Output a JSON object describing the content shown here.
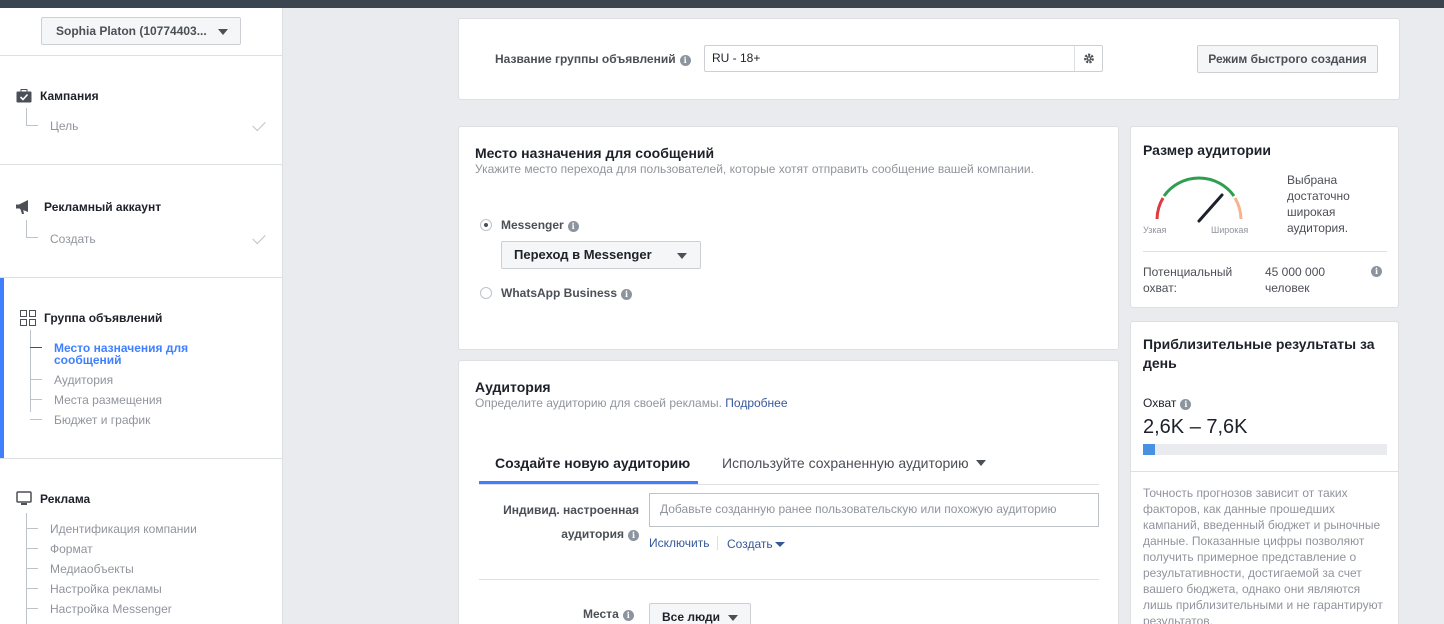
{
  "sidebar": {
    "account_name": "Sophia Platon (10774403...",
    "sections": [
      {
        "title": "Кампания",
        "items": [
          "Цель"
        ]
      },
      {
        "title": "Рекламный аккаунт",
        "items": [
          "Создать"
        ]
      },
      {
        "title": "Группа объявлений",
        "items": [
          "Место назначения для сообщений",
          "Аудитория",
          "Места размещения",
          "Бюджет и график"
        ]
      },
      {
        "title": "Реклама",
        "items": [
          "Идентификация компании",
          "Формат",
          "Медиаобъекты",
          "Настройка рекламы",
          "Настройка Messenger"
        ]
      }
    ]
  },
  "adset": {
    "name_label": "Название группы объявлений",
    "name_value": "RU - 18+",
    "quick_create_label": "Режим быстрого создания"
  },
  "destination": {
    "title": "Место назначения для сообщений",
    "subtitle": "Укажите место перехода для пользователей, которые хотят отправить сообщение вашей компании.",
    "option_messenger": "Messenger",
    "messenger_dropdown": "Переход в Messenger",
    "option_whatsapp": "WhatsApp Business",
    "selected": "Messenger"
  },
  "audience": {
    "title": "Аудитория",
    "subtitle": "Определите аудиторию для своей рекламы.",
    "more_link": "Подробнее",
    "tab_new": "Создайте новую аудиторию",
    "tab_saved": "Используйте сохраненную аудиторию",
    "custom_label_line1": "Индивид. настроенная",
    "custom_label_line2": "аудитория",
    "custom_placeholder": "Добавьте созданную ранее пользовательскую или похожую аудиторию",
    "exclude_link": "Исключить",
    "create_link": "Создать",
    "places_label": "Места",
    "places_value": "Все люди"
  },
  "audience_size": {
    "title": "Размер аудитории",
    "narrow_label": "Узкая",
    "wide_label": "Широкая",
    "status_text": "Выбрана достаточно широкая аудитория.",
    "reach_label": "Потенциальный охват:",
    "reach_value": "45 000 000 человек"
  },
  "daily_results": {
    "title": "Приблизительные результаты за день",
    "reach_label": "Охват",
    "reach_range": "2,6K – 7,6K",
    "reach_bar_fraction": 0.05,
    "note": "Точность прогнозов зависит от таких факторов, как данные прошедших кампаний, введенный бюджет и рыночные данные. Показанные цифры позволяют получить примерное представление о результативности, достигаемой за счет вашего бюджета, однако они являются лишь приблизительными и не гарантируют результатов."
  },
  "colors": {
    "accent": "#4080ff",
    "link": "#365899",
    "gauge_red": "#e0393e",
    "gauge_green": "#2e9e4f",
    "gauge_orange": "#f7b28e"
  }
}
